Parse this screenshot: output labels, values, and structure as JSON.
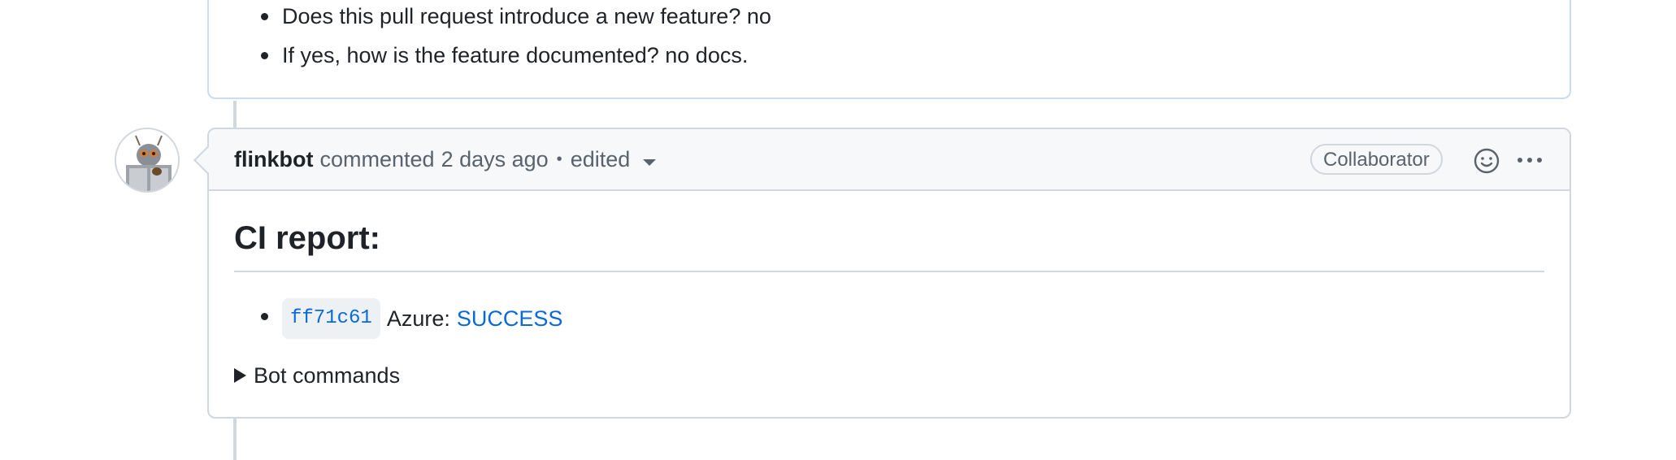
{
  "previous_comment": {
    "items": [
      "Does this pull request introduce a new feature? no",
      "If yes, how is the feature documented? no docs."
    ]
  },
  "comment": {
    "author": "flinkbot",
    "action": "commented",
    "time": "2 days ago",
    "separator": "•",
    "edited_label": "edited",
    "role_badge": "Collaborator",
    "title": "CI report:",
    "ci_items": [
      {
        "sha": "ff71c61",
        "label": "Azure:",
        "status": "SUCCESS"
      }
    ],
    "details_summary": "Bot commands"
  },
  "colors": {
    "link": "#0969da",
    "border": "#d0d7de",
    "header_bg": "#f6f8fa",
    "prev_border": "#c8dcf2"
  },
  "icons": {
    "avatar": "flinkbot-squirrel-avatar",
    "reaction": "smiley-icon",
    "menu": "kebab-horizontal-icon",
    "dropdown": "triangle-down-icon",
    "disclosure": "triangle-right-icon"
  }
}
